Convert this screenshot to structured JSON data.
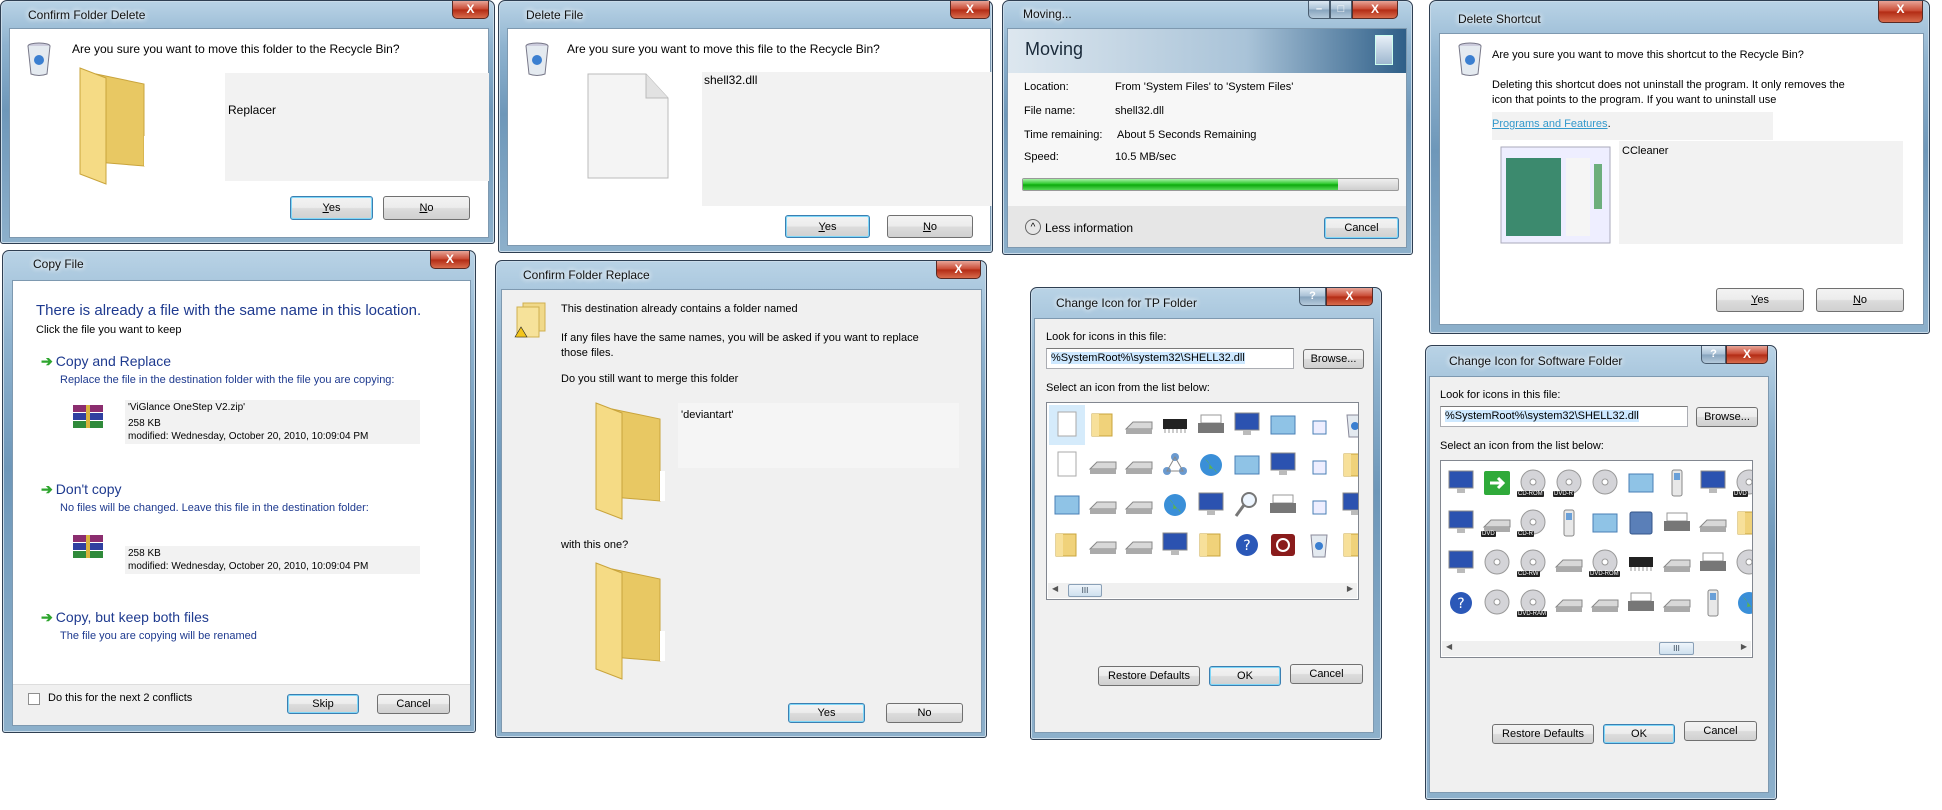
{
  "confirm_folder_delete": {
    "title": "Confirm Folder Delete",
    "close": "X",
    "question": "Are you sure you want to move this folder to the Recycle Bin?",
    "item_name": "Replacer",
    "yes": "Yes",
    "no": "No"
  },
  "delete_file": {
    "title": "Delete File",
    "close": "X",
    "question": "Are you sure you want to move this file to the Recycle Bin?",
    "item_name": "shell32.dll",
    "yes": "Yes",
    "no": "No"
  },
  "moving": {
    "title": "Moving...",
    "header": "Moving",
    "minimize": "–",
    "maximize": "□",
    "close": "X",
    "rows": [
      {
        "label": "Location:",
        "value": "From 'System Files' to 'System Files'"
      },
      {
        "label": "File name:",
        "value": "shell32.dll"
      },
      {
        "label": "Time remaining:",
        "value": "About 5 Seconds Remaining"
      },
      {
        "label": "Speed:",
        "value": "10.5 MB/sec"
      }
    ],
    "progress": 0.84,
    "less_info": "Less information",
    "less_icon": "^",
    "cancel": "Cancel"
  },
  "delete_shortcut": {
    "title": "Delete Shortcut",
    "close": "X",
    "question": "Are you sure you want to move this shortcut to the Recycle Bin?",
    "detail_line1": "Deleting this shortcut does not uninstall the program. It only removes the",
    "detail_line2": "icon that points to the program. If you want to uninstall use",
    "link": "Programs and Features",
    "link_suffix": ".",
    "item_name": "CCleaner",
    "yes": "Yes",
    "no": "No"
  },
  "copy_file": {
    "title": "Copy File",
    "close": "X",
    "heading": "There is already a file with the same name in this location.",
    "instruction": "Click the file you want to keep",
    "options": [
      {
        "title": "Copy and Replace",
        "desc": "Replace the file in the destination folder with the file you are copying:"
      },
      {
        "title": "Don't copy",
        "desc": "No files will be changed. Leave this file in the destination folder:"
      },
      {
        "title": "Copy, but keep both files",
        "desc": "The file you are copying will be renamed"
      }
    ],
    "arrow": "➔",
    "source_file": {
      "name": "'ViGlance OneStep V2.zip'",
      "size": "258 KB",
      "modified": "modified: Wednesday, October 20, 2010, 10:09:04 PM"
    },
    "dest_file": {
      "size": "258 KB",
      "modified": "modified: Wednesday, October 20, 2010, 10:09:04 PM"
    },
    "checkbox_label": "Do this for the next 2 conflicts",
    "skip": "Skip",
    "cancel": "Cancel"
  },
  "confirm_folder_replace": {
    "title": "Confirm Folder Replace",
    "close": "X",
    "line1": "This destination already contains a folder named",
    "line2a": "If any files have the same names, you will be asked if you want to replace",
    "line2b": "those files.",
    "line3": "Do you still want to merge this folder",
    "folder_name": "'deviantart'",
    "line4": "with this one?",
    "yes": "Yes",
    "no": "No"
  },
  "change_icon_tp": {
    "title": "Change Icon for TP Folder",
    "help": "?",
    "close": "X",
    "look_label": "Look for icons in this file:",
    "path": "%SystemRoot%\\system32\\SHELL32.dll",
    "browse": "Browse...",
    "select_label": "Select an icon from the list below:",
    "thumb": "III",
    "restore": "Restore Defaults",
    "ok": "OK",
    "cancel": "Cancel",
    "icons": [
      {
        "icon": "blank-document",
        "kind": "doc"
      },
      {
        "icon": "folder",
        "kind": "folder"
      },
      {
        "icon": "drive",
        "kind": "drive"
      },
      {
        "icon": "memory-chip",
        "kind": "chip"
      },
      {
        "icon": "printer",
        "kind": "printer"
      },
      {
        "icon": "network-settings",
        "kind": "monitor"
      },
      {
        "icon": "display-frame",
        "kind": "panel"
      },
      {
        "icon": "small-32-icon",
        "kind": "small"
      },
      {
        "icon": "recycle-bin",
        "kind": "bin"
      },
      {
        "icon": "text-document",
        "kind": "doc"
      },
      {
        "icon": "floppy-drive",
        "kind": "drive"
      },
      {
        "icon": "network-drive",
        "kind": "drive"
      },
      {
        "icon": "network-share",
        "kind": "network"
      },
      {
        "icon": "globe-computer",
        "kind": "globe"
      },
      {
        "icon": "control-panel",
        "kind": "panel"
      },
      {
        "icon": "monitor-moon",
        "kind": "monitor"
      },
      {
        "icon": "shortcut-arrow",
        "kind": "small"
      },
      {
        "icon": "phone-folder",
        "kind": "folder"
      },
      {
        "icon": "application-window",
        "kind": "panel"
      },
      {
        "icon": "floppy-drive-purple",
        "kind": "drive"
      },
      {
        "icon": "drive-delete",
        "kind": "drive"
      },
      {
        "icon": "globe",
        "kind": "globe"
      },
      {
        "icon": "network-computers",
        "kind": "monitor"
      },
      {
        "icon": "search-magnifier",
        "kind": "search"
      },
      {
        "icon": "printer-cd",
        "kind": "printer"
      },
      {
        "icon": "clock",
        "kind": "small"
      },
      {
        "icon": "laptop",
        "kind": "monitor"
      },
      {
        "icon": "folder-files",
        "kind": "folder"
      },
      {
        "icon": "hard-drive",
        "kind": "drive"
      },
      {
        "icon": "cd-drive",
        "kind": "drive"
      },
      {
        "icon": "desktop-computer",
        "kind": "monitor"
      },
      {
        "icon": "folder-blank",
        "kind": "folder"
      },
      {
        "icon": "help-folder",
        "kind": "help"
      },
      {
        "icon": "power-button",
        "kind": "power"
      },
      {
        "icon": "recycle-bin-full",
        "kind": "bin"
      },
      {
        "icon": "folder",
        "kind": "folder"
      }
    ]
  },
  "change_icon_software": {
    "title": "Change Icon for Software Folder",
    "help": "?",
    "close": "X",
    "look_label": "Look for icons in this file:",
    "path": "%SystemRoot%\\system32\\SHELL32.dll",
    "browse": "Browse...",
    "select_label": "Select an icon from the list below:",
    "thumb": "III",
    "restore": "Restore Defaults",
    "ok": "OK",
    "cancel": "Cancel",
    "icons": [
      {
        "icon": "computer-chat",
        "kind": "monitor"
      },
      {
        "icon": "green-arrow",
        "kind": "arrow"
      },
      {
        "icon": "cd-rom",
        "kind": "disc",
        "tag": "CD-ROM"
      },
      {
        "icon": "dvd-r",
        "kind": "disc",
        "tag": "DVD-R"
      },
      {
        "icon": "cd",
        "kind": "disc"
      },
      {
        "icon": "display-panel",
        "kind": "panel"
      },
      {
        "icon": "mobile-phone",
        "kind": "phone"
      },
      {
        "icon": "pda",
        "kind": "monitor"
      },
      {
        "icon": "dvd",
        "kind": "disc",
        "tag": "DVD"
      },
      {
        "icon": "keyboard-computer",
        "kind": "monitor"
      },
      {
        "icon": "dvd-drive",
        "kind": "drive",
        "tag": "DVD"
      },
      {
        "icon": "cd-r",
        "kind": "disc",
        "tag": "CD-R"
      },
      {
        "icon": "phone-cradle",
        "kind": "phone"
      },
      {
        "icon": "tv-screen",
        "kind": "panel"
      },
      {
        "icon": "folder-blue",
        "kind": "bluefolder"
      },
      {
        "icon": "network-printer",
        "kind": "printer"
      },
      {
        "icon": "scanner",
        "kind": "drive"
      },
      {
        "icon": "folder-yellow",
        "kind": "folder"
      },
      {
        "icon": "monitor-contrast",
        "kind": "monitor"
      },
      {
        "icon": "music-cd",
        "kind": "disc"
      },
      {
        "icon": "cd-rw",
        "kind": "disc",
        "tag": "CD-RW"
      },
      {
        "icon": "server-box",
        "kind": "drive"
      },
      {
        "icon": "dvd-rom",
        "kind": "disc",
        "tag": "DVD-ROM"
      },
      {
        "icon": "memory-card",
        "kind": "chip"
      },
      {
        "icon": "disc-drive",
        "kind": "drive"
      },
      {
        "icon": "camera-printer",
        "kind": "printer"
      },
      {
        "icon": "cd-blue",
        "kind": "disc"
      },
      {
        "icon": "help",
        "kind": "help"
      },
      {
        "icon": "cd-question",
        "kind": "disc"
      },
      {
        "icon": "dvd-ram",
        "kind": "disc",
        "tag": "DVD-RAM"
      },
      {
        "icon": "tower-case",
        "kind": "drive"
      },
      {
        "icon": "removable-drive",
        "kind": "drive"
      },
      {
        "icon": "camera",
        "kind": "printer"
      },
      {
        "icon": "flat-drive",
        "kind": "drive"
      },
      {
        "icon": "video-camera",
        "kind": "phone"
      },
      {
        "icon": "map",
        "kind": "globe"
      }
    ]
  }
}
